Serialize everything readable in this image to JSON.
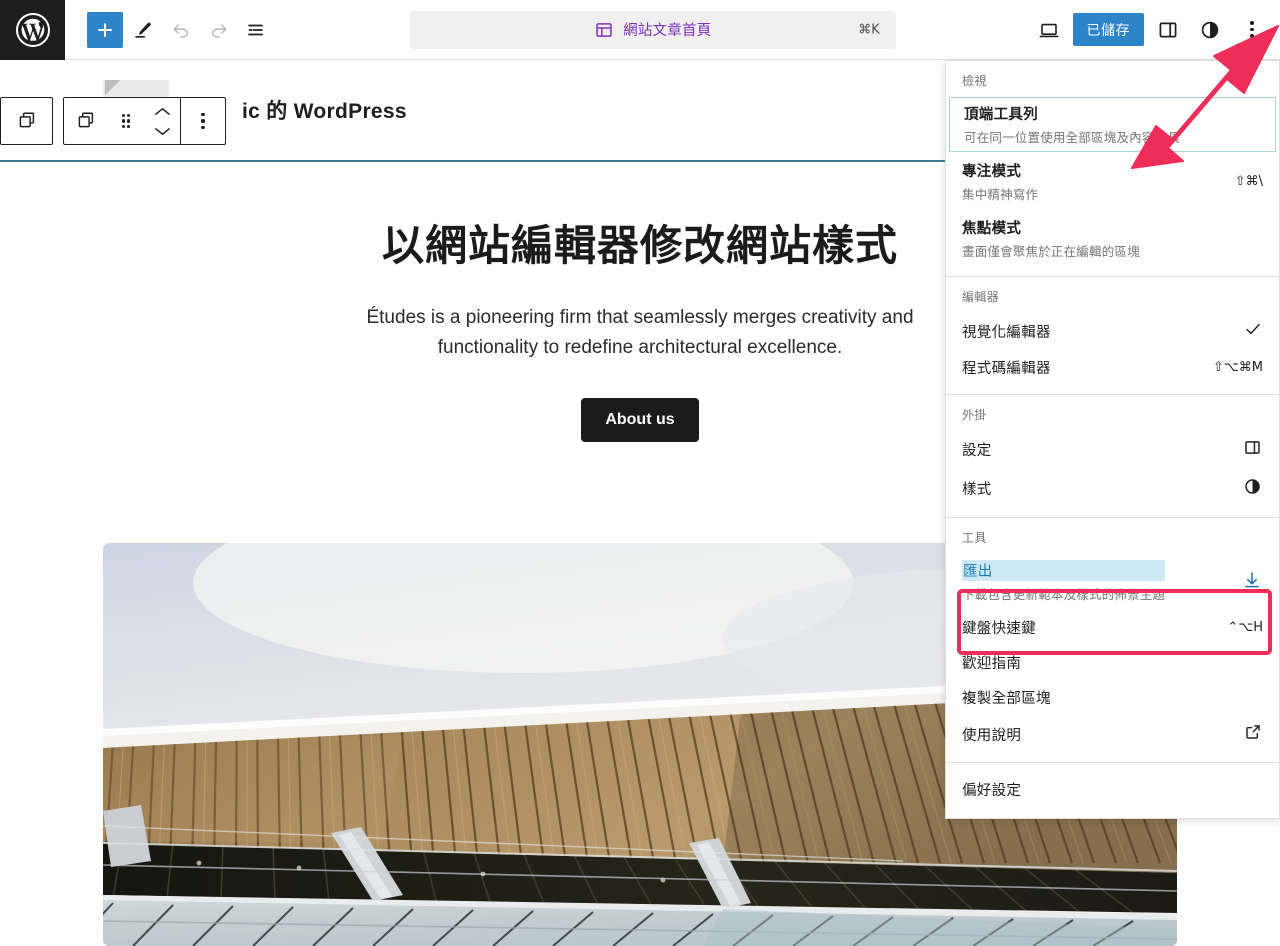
{
  "header": {
    "logo_icon": "wordpress-logo-icon",
    "left_tools": [
      {
        "name": "add-block-button",
        "icon": "plus-icon",
        "label": "新增區塊"
      },
      {
        "name": "edit-tool-button",
        "icon": "pencil-icon",
        "label": "編輯"
      },
      {
        "name": "undo-button",
        "icon": "undo-arrow-icon",
        "label": "復原",
        "disabled": true
      },
      {
        "name": "redo-button",
        "icon": "redo-arrow-icon",
        "label": "重做",
        "disabled": true
      },
      {
        "name": "document-overview-button",
        "icon": "list-view-icon",
        "label": "文件概覽"
      }
    ],
    "command_bar": {
      "icon": "template-layout-icon",
      "label": "網站文章首頁",
      "shortcut": "⌘K"
    },
    "right_tools": {
      "device_preview_label": "檢視裝置",
      "device_preview_icon": "laptop-icon",
      "save_label": "已儲存",
      "settings_icon": "sidebar-panel-icon",
      "settings_label": "設定",
      "styles_icon": "contrast-circle-icon",
      "styles_label": "樣式",
      "options_icon": "three-dots-vertical-icon",
      "options_label": "選項"
    }
  },
  "block_toolbar": {
    "block_type_icon": "group-block-icon",
    "parent_block_icon": "group-block-icon",
    "drag_handle_icon": "drag-dots-icon",
    "move_up_icon": "chevron-up-icon",
    "move_down_icon": "chevron-down-icon",
    "more_options_icon": "three-dots-vertical-icon"
  },
  "canvas": {
    "site_title": "ic 的 WordPress",
    "post_title": "以網站編輯器修改網站樣式",
    "post_excerpt": "Études is a pioneering firm that seamlessly merges creativity and functionality to redefine architectural excellence.",
    "cta_label": "About us",
    "featured_image_alt": "architectural-building-photo"
  },
  "menu": {
    "groups": [
      {
        "label": "檢視",
        "items": [
          {
            "title": "頂端工具列",
            "desc": "可在同一位置使用全部區塊及內容工具",
            "shortcut": "",
            "focused": true,
            "icon": ""
          },
          {
            "title": "專注模式",
            "desc": "集中精神寫作",
            "shortcut": "⇧⌘\\",
            "icon": ""
          },
          {
            "title": "焦點模式",
            "desc": "畫面僅會聚焦於正在編輯的區塊",
            "shortcut": "",
            "icon": ""
          }
        ]
      },
      {
        "label": "編輯器",
        "items": [
          {
            "title": "視覺化編輯器",
            "desc": "",
            "shortcut": "",
            "icon": "checkmark-icon"
          },
          {
            "title": "程式碼編輯器",
            "desc": "",
            "shortcut": "⇧⌥⌘M",
            "icon": ""
          }
        ]
      },
      {
        "label": "外掛",
        "items": [
          {
            "title": "設定",
            "desc": "",
            "shortcut": "",
            "icon": "sidebar-panel-icon"
          },
          {
            "title": "樣式",
            "desc": "",
            "shortcut": "",
            "icon": "contrast-circle-icon"
          }
        ]
      },
      {
        "label": "工具",
        "items": [
          {
            "title": "匯出",
            "desc": "下載包含更新範本及樣式的佈景主題",
            "shortcut": "",
            "icon": "download-icon",
            "highlighted": true
          },
          {
            "title": "鍵盤快速鍵",
            "desc": "",
            "shortcut": "⌃⌥H",
            "icon": ""
          },
          {
            "title": "歡迎指南",
            "desc": "",
            "shortcut": "",
            "icon": ""
          },
          {
            "title": "複製全部區塊",
            "desc": "",
            "shortcut": "",
            "icon": ""
          },
          {
            "title": "使用說明",
            "desc": "",
            "shortcut": "",
            "icon": "external-link-icon"
          }
        ]
      },
      {
        "label": "",
        "items": [
          {
            "title": "偏好設定",
            "desc": "",
            "shortcut": "",
            "icon": ""
          }
        ]
      }
    ]
  },
  "annotations": {
    "arrow_color": "#ee2e58",
    "highlight_box_color": "#ee2e58",
    "arrow_target": "options-kebab-button",
    "highlight_target": "menu-item-export"
  },
  "colors": {
    "accent_blue": "#2d84c8",
    "command_purple": "#7f2ebd",
    "selection_border": "#3a7d92",
    "annotation_red": "#ee2e58"
  }
}
